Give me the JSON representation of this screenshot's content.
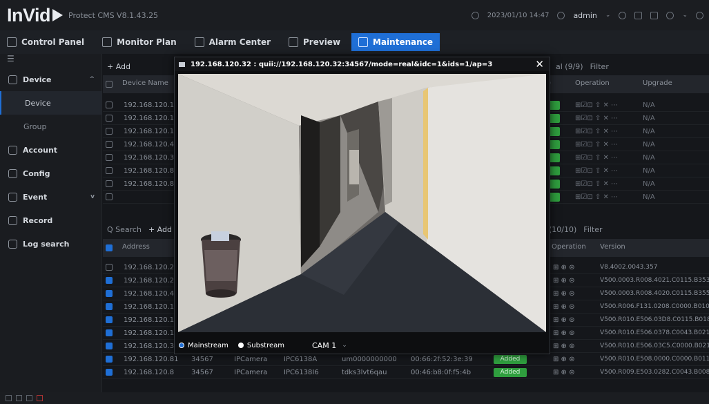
{
  "app": {
    "version": "Protect CMS V8.1.43.25"
  },
  "topbar": {
    "datetime": "2023/01/10 14:47",
    "user": "admin"
  },
  "nav": [
    {
      "label": "Control Panel"
    },
    {
      "label": "Monitor Plan"
    },
    {
      "label": "Alarm Center"
    },
    {
      "label": "Preview"
    },
    {
      "label": "Maintenance"
    }
  ],
  "sidebar": {
    "device": "Device",
    "sub_device": "Device",
    "sub_group": "Group",
    "account": "Account",
    "config": "Config",
    "event": "Event",
    "record": "Record",
    "log_search": "Log search"
  },
  "upper_table": {
    "add": "+ Add",
    "count": "al (9/9)",
    "filter": "Filter",
    "col_name": "Device Name",
    "col_operation": "Operation",
    "col_upgrade": "Upgrade",
    "col_status": "s)",
    "rows": [
      {
        "name": "192.168.120.118",
        "upgrade": "N/A"
      },
      {
        "name": "192.168.120.19",
        "upgrade": "N/A"
      },
      {
        "name": "192.168.120.130",
        "upgrade": "N/A"
      },
      {
        "name": "192.168.120.42",
        "upgrade": "N/A"
      },
      {
        "name": "192.168.120.31",
        "upgrade": "N/A"
      },
      {
        "name": "192.168.120.81",
        "upgrade": "N/A"
      },
      {
        "name": "192.168.120.8",
        "upgrade": "N/A"
      },
      {
        "name": "",
        "upgrade": "N/A"
      }
    ],
    "op_icons": "⊞☑⊡ ⇧ ✕ ⋯"
  },
  "lower_table": {
    "search": "Q Search",
    "add": "+ Add",
    "count": "(10/10)",
    "filter": "Filter",
    "col_address": "Address",
    "col_operation": "Operation",
    "col_version": "Version",
    "op_icons": "⊞ ⊕ ⊜",
    "rows": [
      {
        "address": "192.168.120.26",
        "version": "V8.4002.0043.357",
        "checked": false
      },
      {
        "address": "192.168.120.211",
        "version": "V500.0003.R008.4021.C0115.B353.",
        "checked": true
      },
      {
        "address": "192.168.120.42",
        "version": "V500.0003.R008.4020.C0115.B355.",
        "checked": true
      },
      {
        "address": "192.168.120.118",
        "version": "V500.R006.F131.0208.C0000.B010",
        "checked": true
      },
      {
        "address": "192.168.120.19",
        "version": "V500.R010.E506.03D8.C0115.B018",
        "checked": true
      },
      {
        "address": "192.168.120.130",
        "version": "V500.R010.E506.0378.C0043.B021",
        "checked": true
      },
      {
        "address": "192.168.120.31",
        "version": "V500.R010.E506.03C5.C0000.B021",
        "checked": true
      },
      {
        "address": "192.168.120.81",
        "port": "34567",
        "type": "IPCamera",
        "model": "IPC6138A",
        "sn": "um0000000000",
        "mac": "00:66:2f:52:3e:39",
        "status": "Added",
        "version": "V500.R010.E508.0000.C0000.B011",
        "checked": true
      },
      {
        "address": "192.168.120.8",
        "port": "34567",
        "type": "IPCamera",
        "model": "IPC6138I6",
        "sn": "tdks3lvt6qau",
        "mac": "00:46:b8:0f:f5:4b",
        "status": "Added",
        "version": "V500.R009.E503.0282.C0043.B008",
        "checked": true
      }
    ]
  },
  "dialog": {
    "title": "192.168.120.32 : quii://192.168.120.32:34567/mode=real&idc=1&ids=1/ap=3",
    "close": "✕",
    "mainstream": "Mainstream",
    "substream": "Substream",
    "camera": "CAM 1"
  }
}
